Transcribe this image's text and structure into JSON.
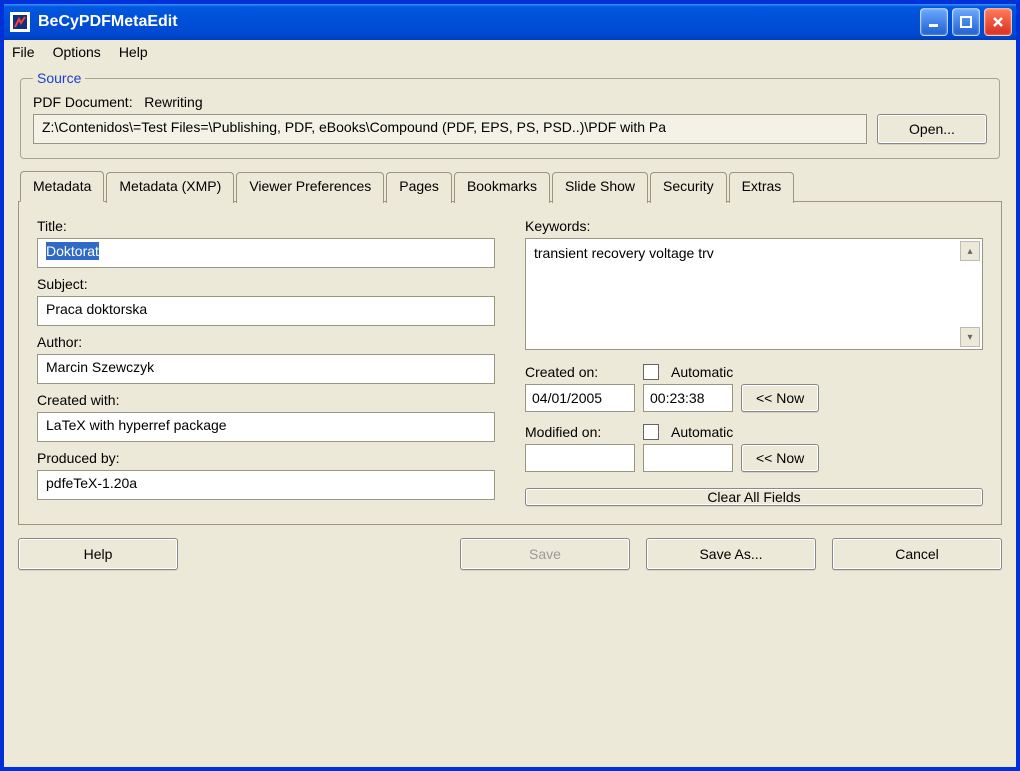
{
  "window": {
    "title": "BeCyPDFMetaEdit"
  },
  "menubar": [
    "File",
    "Options",
    "Help"
  ],
  "source": {
    "legend": "Source",
    "label": "PDF Document:",
    "mode": "Rewriting",
    "path": "Z:\\Contenidos\\=Test Files=\\Publishing, PDF, eBooks\\Compound (PDF, EPS, PS, PSD..)\\PDF with Pa",
    "open": "Open..."
  },
  "tabs": [
    "Metadata",
    "Metadata (XMP)",
    "Viewer Preferences",
    "Pages",
    "Bookmarks",
    "Slide Show",
    "Security",
    "Extras"
  ],
  "active_tab": 0,
  "metadata": {
    "title_label": "Title:",
    "title": "Doktorat",
    "subject_label": "Subject:",
    "subject": "Praca doktorska",
    "author_label": "Author:",
    "author": "Marcin Szewczyk",
    "created_with_label": "Created with:",
    "created_with": "LaTeX with hyperref package",
    "produced_by_label": "Produced by:",
    "produced_by": "pdfeTeX-1.20a",
    "keywords_label": "Keywords:",
    "keywords": "transient recovery voltage trv",
    "created_on_label": "Created on:",
    "created_date": "04/01/2005",
    "created_time": "00:23:38",
    "modified_on_label": "Modified on:",
    "modified_date": "",
    "modified_time": "",
    "automatic_label": "Automatic",
    "now_label": "<< Now",
    "clear_label": "Clear All Fields"
  },
  "buttons": {
    "help": "Help",
    "save": "Save",
    "save_as": "Save As...",
    "cancel": "Cancel"
  }
}
